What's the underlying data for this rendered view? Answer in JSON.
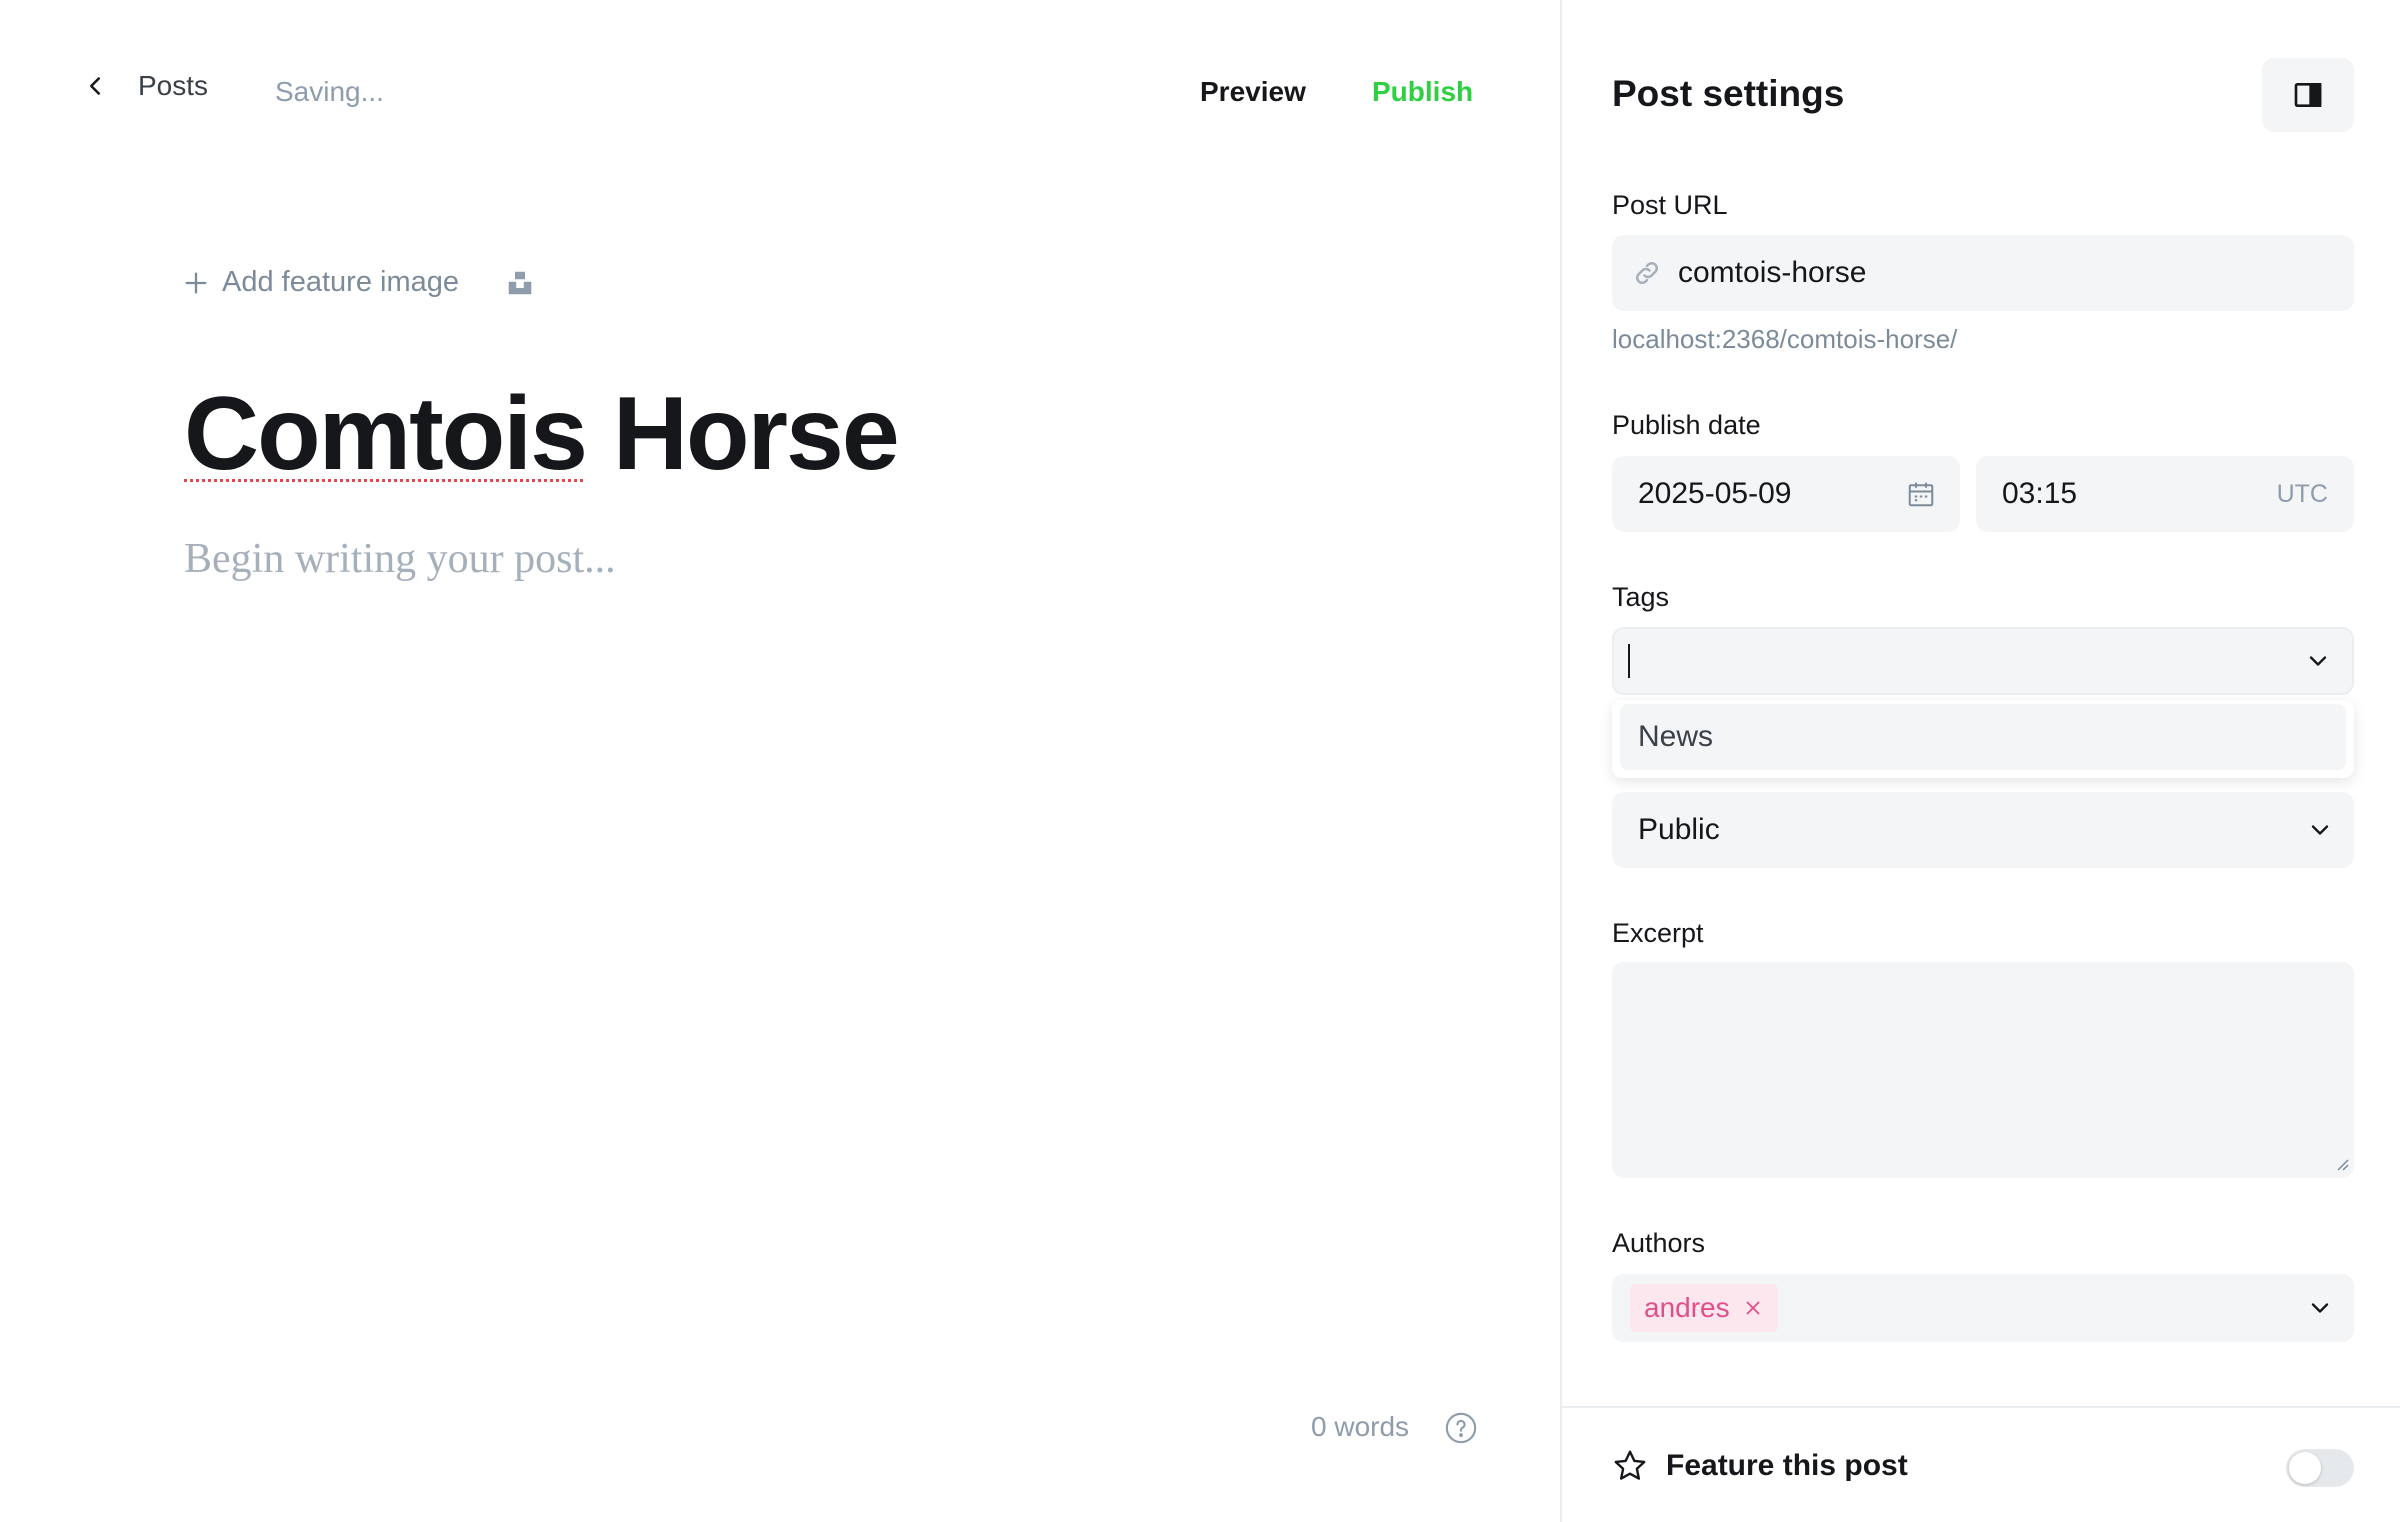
{
  "topbar": {
    "back_label": "Posts",
    "status": "Saving...",
    "preview_label": "Preview",
    "publish_label": "Publish"
  },
  "editor": {
    "add_feature_image_label": "Add feature image",
    "title_first_word": "Comtois",
    "title_rest": " Horse",
    "body_placeholder": "Begin writing your post...",
    "word_count": "0 words"
  },
  "settings": {
    "title": "Post settings",
    "post_url": {
      "label": "Post URL",
      "value": "comtois-horse",
      "hint": "localhost:2368/comtois-horse/"
    },
    "publish_date": {
      "label": "Publish date",
      "date": "2025-05-09",
      "time": "03:15",
      "timezone": "UTC"
    },
    "tags": {
      "label": "Tags",
      "value": "",
      "options": [
        "News"
      ]
    },
    "visibility": {
      "value": "Public"
    },
    "excerpt": {
      "label": "Excerpt",
      "value": ""
    },
    "authors": {
      "label": "Authors",
      "items": [
        "andres"
      ]
    },
    "feature_post": {
      "label": "Feature this post",
      "enabled": false
    }
  },
  "colors": {
    "accent_green": "#30cf43",
    "author_chip_text": "#e14f8a",
    "author_chip_bg": "#fde7ef",
    "input_bg": "#f4f5f6"
  }
}
